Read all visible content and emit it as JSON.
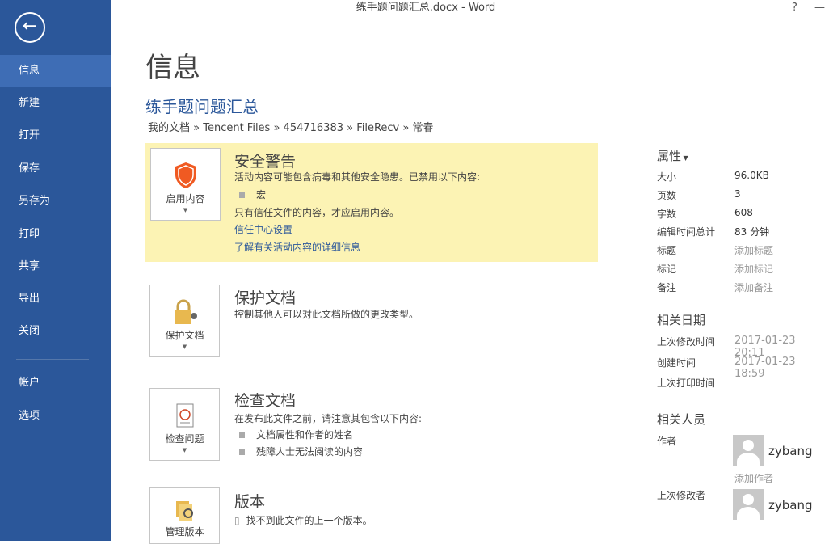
{
  "window": {
    "title": "练手题问题汇总.docx - Word",
    "help": "?",
    "minimize": "—"
  },
  "sidebar": {
    "items": [
      "信息",
      "新建",
      "打开",
      "保存",
      "另存为",
      "打印",
      "共享",
      "导出",
      "关闭"
    ],
    "bottom_items": [
      "帐户",
      "选项"
    ]
  },
  "page": {
    "title": "信息",
    "doc_name": "练手题问题汇总",
    "breadcrumb": "我的文档 » Tencent Files » 454716383 » FileRecv » 常春"
  },
  "security": {
    "button": "启用内容",
    "heading": "安全警告",
    "desc": "活动内容可能包含病毒和其他安全隐患。已禁用以下内容:",
    "item": "宏",
    "note": "只有信任文件的内容，才应启用内容。",
    "link1": "信任中心设置",
    "link2": "了解有关活动内容的详细信息"
  },
  "protect": {
    "button": "保护文档",
    "heading": "保护文档",
    "desc": "控制其他人可以对此文档所做的更改类型。"
  },
  "inspect": {
    "button": "检查问题",
    "heading": "检查文档",
    "desc": "在发布此文件之前，请注意其包含以下内容:",
    "items": [
      "文档属性和作者的姓名",
      "残障人士无法阅读的内容"
    ]
  },
  "versions": {
    "button": "管理版本",
    "heading": "版本",
    "desc": "找不到此文件的上一个版本。"
  },
  "properties": {
    "heading": "属性",
    "rows": [
      [
        "大小",
        "96.0KB"
      ],
      [
        "页数",
        "3"
      ],
      [
        "字数",
        "608"
      ],
      [
        "编辑时间总计",
        "83 分钟"
      ],
      [
        "标题",
        "添加标题"
      ],
      [
        "标记",
        "添加标记"
      ],
      [
        "备注",
        "添加备注"
      ]
    ]
  },
  "dates": {
    "heading": "相关日期",
    "rows": [
      [
        "上次修改时间",
        "2017-01-23 20:11"
      ],
      [
        "创建时间",
        "2017-01-23 18:59"
      ],
      [
        "上次打印时间",
        ""
      ]
    ]
  },
  "people": {
    "heading": "相关人员",
    "author_label": "作者",
    "author": "zybang",
    "add_author": "添加作者",
    "modifier_label": "上次修改者",
    "modifier": "zybang"
  }
}
